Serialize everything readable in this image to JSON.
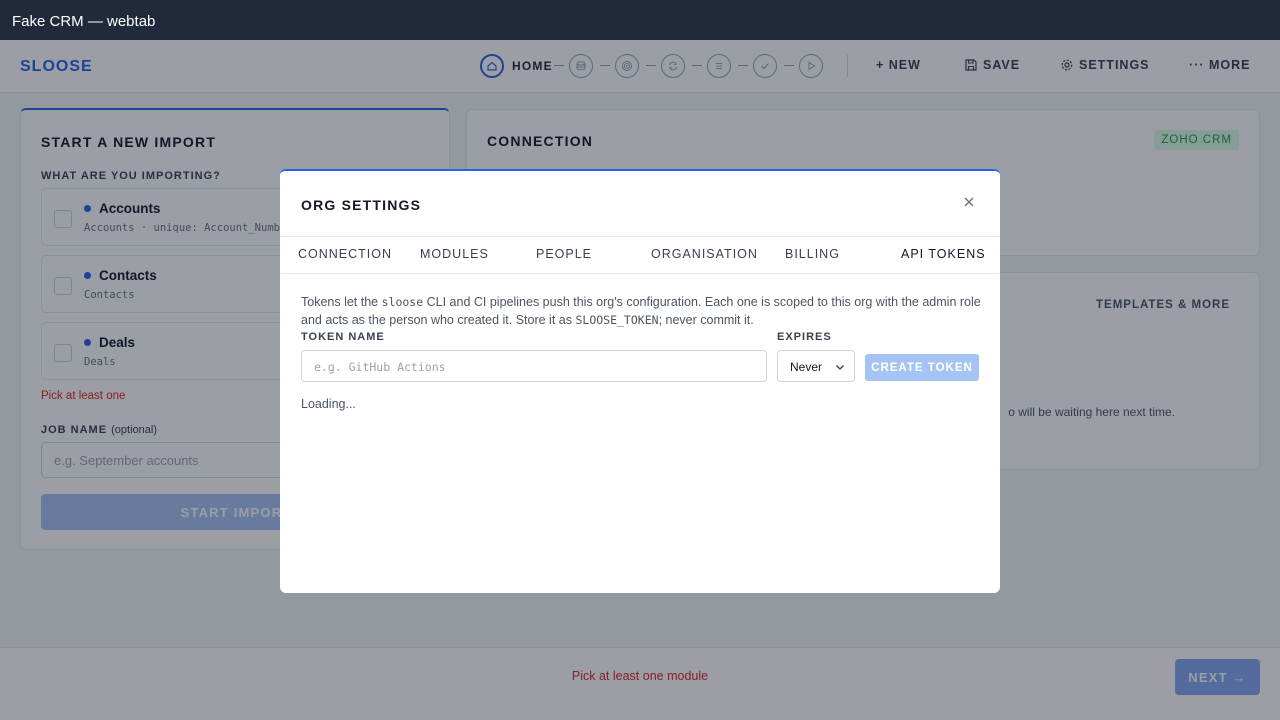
{
  "window": {
    "title": "Fake CRM — webtab"
  },
  "header": {
    "brand": "SLOOSE",
    "stepper": {
      "current_label": "HOME"
    },
    "actions": {
      "new": "+ NEW",
      "save": "SAVE",
      "settings": "SETTINGS",
      "more": "··· MORE"
    }
  },
  "import_card": {
    "title": "START A NEW IMPORT",
    "question": "WHAT ARE YOU IMPORTING?",
    "modules": [
      {
        "name": "Accounts",
        "detail": "Accounts · unique: Account_Number"
      },
      {
        "name": "Contacts",
        "detail": "Contacts"
      },
      {
        "name": "Deals",
        "detail": "Deals"
      }
    ],
    "error": "Pick at least one",
    "job_name_label": "JOB NAME",
    "job_name_optional": "(optional)",
    "job_name_placeholder": "e.g. September accounts",
    "start_button": "START IMPORT"
  },
  "connection_card": {
    "title": "CONNECTION",
    "badge": "ZOHO CRM"
  },
  "templates_card": {
    "link": "TEMPLATES & MORE",
    "hint_fragment": "o will be waiting here next time."
  },
  "footer": {
    "message": "Pick at least one module",
    "next_button": "NEXT →"
  },
  "modal": {
    "title": "ORG SETTINGS",
    "tabs": [
      "CONNECTION",
      "MODULES",
      "PEOPLE",
      "ORGANISATION",
      "BILLING",
      "API TOKENS"
    ],
    "help": {
      "p1": "Tokens let the ",
      "code1": "sloose",
      "p2": " CLI and CI pipelines push this org's configuration. Each one is scoped to this org with the admin role and acts as the person who created it. Store it as ",
      "code2": "SLOOSE_TOKEN",
      "p3": "; never commit it."
    },
    "token_name_label": "TOKEN NAME",
    "token_name_placeholder": "e.g. GitHub Actions",
    "expires_label": "EXPIRES",
    "expires_value": "Never",
    "create_button": "CREATE TOKEN",
    "loading": "Loading..."
  },
  "colors": {
    "accent": "#2563eb",
    "error": "#dc2626",
    "success": "#16a34a",
    "titlebar": "#202a3b"
  }
}
